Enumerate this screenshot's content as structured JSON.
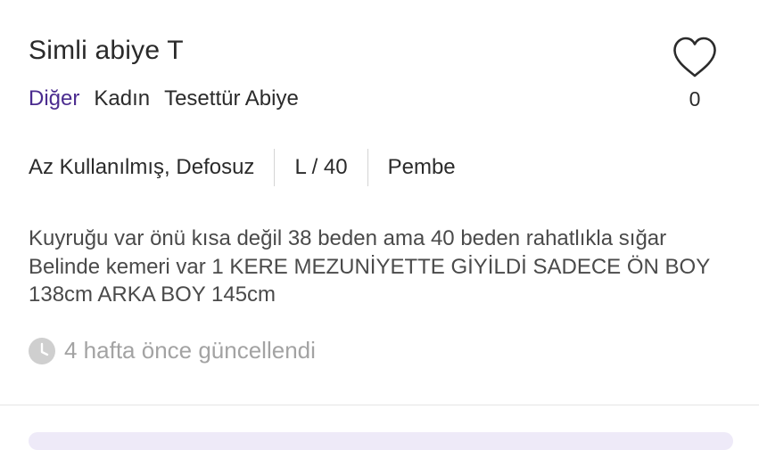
{
  "product": {
    "title": "Simli abiye T",
    "breadcrumbs": [
      "Diğer",
      "Kadın",
      "Tesettür Abiye"
    ],
    "favorite": {
      "icon": "heart-icon",
      "count": "0"
    },
    "attributes": {
      "condition": "Az Kullanılmış, Defosuz",
      "size": "L / 40",
      "color": "Pembe"
    },
    "description": "Kuyruğu var önü kısa değil 38 beden ama 40 beden rahatlıkla sığar Belinde kemeri var 1 KERE MEZUNİYETTE GİYİLDİ SADECE ÖN BOY 138cm ARKA BOY 145cm",
    "updated": {
      "icon": "clock-icon",
      "text": "4 hafta önce güncellendi"
    }
  },
  "colors": {
    "accent": "#4b2c8f",
    "muted": "#a3a3a3",
    "text": "#2b2b2b"
  }
}
